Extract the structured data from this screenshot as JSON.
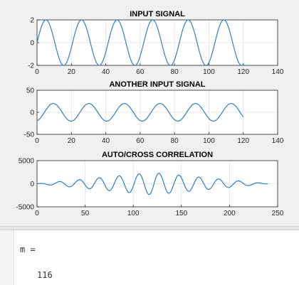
{
  "colors": {
    "line": "#2f7fc1",
    "axes_bg": "#ffffff",
    "grid": "#e3e3e3",
    "figure_bg": "#f0f0f0"
  },
  "command_window": {
    "variable": "m =",
    "value": "116"
  },
  "chart_data": [
    {
      "type": "line",
      "title": "INPUT SIGNAL",
      "xlim": [
        0,
        140
      ],
      "ylim": [
        -2,
        2
      ],
      "xticks": [
        0,
        20,
        40,
        60,
        80,
        100,
        120,
        140
      ],
      "yticks": [
        -2,
        0,
        2
      ],
      "grid": true,
      "series": [
        {
          "x_start": 0,
          "x_end": 120,
          "amplitude": 2,
          "period": 20.7,
          "phase": 0,
          "waveform": "sine"
        }
      ]
    },
    {
      "type": "line",
      "title": "ANOTHER INPUT SIGNAL",
      "xlim": [
        0,
        140
      ],
      "ylim": [
        -50,
        50
      ],
      "xticks": [
        0,
        20,
        40,
        60,
        80,
        100,
        120,
        140
      ],
      "yticks": [
        -50,
        0,
        50
      ],
      "grid": true,
      "series": [
        {
          "x_start": 0,
          "x_end": 120,
          "amplitude": 20,
          "period": 20.7,
          "phase": -1.3,
          "waveform": "sine"
        }
      ]
    },
    {
      "type": "line",
      "title": "AUTO/CROSS CORRELATION",
      "xlim": [
        0,
        250
      ],
      "ylim": [
        -5000,
        5000
      ],
      "xticks": [
        0,
        50,
        100,
        150,
        200,
        250
      ],
      "yticks": [
        -5000,
        0,
        5000
      ],
      "grid": true,
      "series": [
        {
          "x_start": 0,
          "x_end": 240,
          "amplitude": 2400,
          "period": 20.7,
          "center": 120,
          "phase": 0.8,
          "waveform": "triangular-envelope sine"
        }
      ]
    }
  ]
}
